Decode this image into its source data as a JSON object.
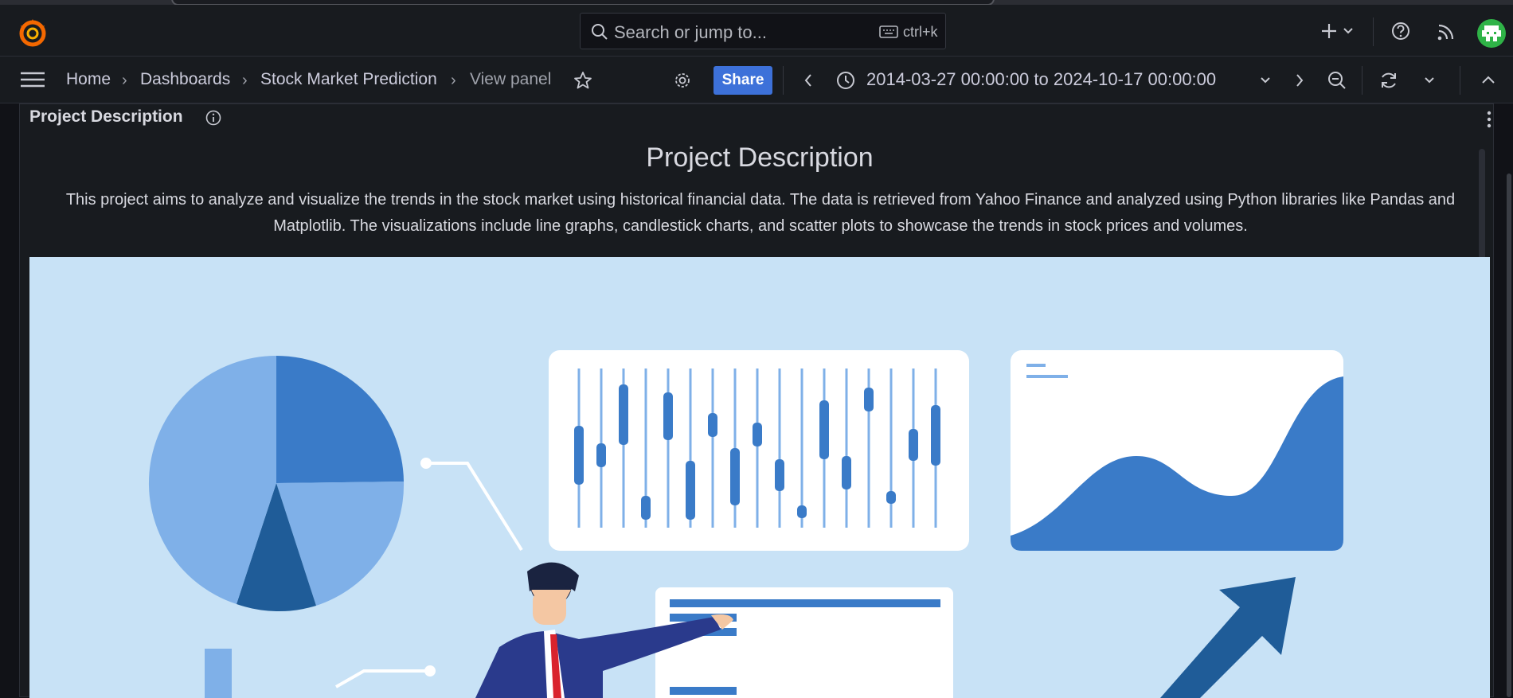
{
  "topbar": {
    "search_placeholder": "Search or jump to...",
    "search_shortcut": "ctrl+k"
  },
  "breadcrumb": {
    "home": "Home",
    "dashboards": "Dashboards",
    "dashboard": "Stock Market Prediction",
    "current": "View panel"
  },
  "toolbar": {
    "share_label": "Share",
    "time_range": "2014-03-27 00:00:00 to 2024-10-17 00:00:00"
  },
  "panel": {
    "title": "Project Description",
    "heading": "Project Description",
    "description": "This project aims to analyze and visualize the trends in the stock market using historical financial data. The data is retrieved from Yahoo Finance and analyzed using Python libraries like Pandas and Matplotlib. The visualizations include line graphs, candlestick charts, and scatter plots to showcase the trends in stock prices and volumes."
  },
  "colors": {
    "accent": "#3d71d9",
    "illustration_bg": "#c8e2f6",
    "chart_dark": "#3a7bc8",
    "chart_light": "#7fb0e8"
  }
}
